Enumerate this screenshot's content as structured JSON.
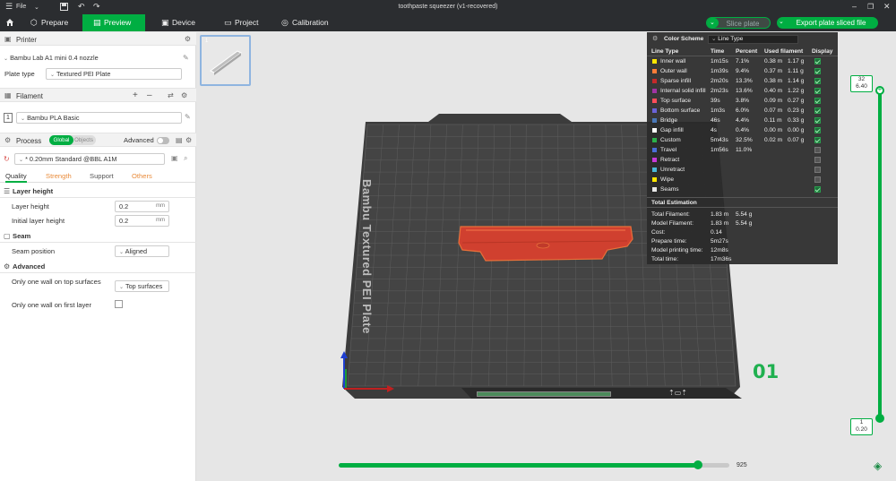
{
  "window": {
    "title": "toothpaste squeezer (v1-recovered)",
    "file_menu": "File"
  },
  "tabs": [
    {
      "label": "Prepare"
    },
    {
      "label": "Preview"
    },
    {
      "label": "Device"
    },
    {
      "label": "Project"
    },
    {
      "label": "Calibration"
    }
  ],
  "toolbar": {
    "slice_label": "Slice plate",
    "export_label": "Export plate sliced file"
  },
  "printer": {
    "header": "Printer",
    "name": "Bambu Lab A1 mini 0.4 nozzle",
    "plate_type_label": "Plate type",
    "plate_type_value": "Textured PEI Plate"
  },
  "filament": {
    "header": "Filament",
    "slot": "1",
    "name": "Bambu PLA Basic"
  },
  "process": {
    "header": "Process",
    "global_label": "Global",
    "objects_label": "Objects",
    "advanced_label": "Advanced",
    "preset": "* 0.20mm Standard @BBL A1M",
    "subtabs": [
      "Quality",
      "Strength",
      "Support",
      "Others"
    ]
  },
  "quality": {
    "layer_height_header": "Layer height",
    "layer_height_label": "Layer height",
    "layer_height_value": "0.2",
    "initial_layer_height_label": "Initial layer height",
    "initial_layer_height_value": "0.2",
    "unit": "mm",
    "seam_header": "Seam",
    "seam_position_label": "Seam position",
    "seam_position_value": "Aligned",
    "advanced_header": "Advanced",
    "one_wall_top_label": "Only one wall on top surfaces",
    "one_wall_top_value": "Top surfaces",
    "one_wall_first_label": "Only one wall on first layer"
  },
  "plate": {
    "bed_label": "Bambu Textured PEI Plate",
    "number": "01",
    "thumb_number": "1"
  },
  "layer_slider": {
    "top_layer": "32",
    "top_height": "6.40",
    "bottom_layer": "1",
    "bottom_height": "0.20"
  },
  "move_slider": {
    "value": "925",
    "fraction": 0.92
  },
  "color_scheme": {
    "title": "Color Scheme",
    "mode": "Line Type",
    "headers": [
      "Line Type",
      "Time",
      "Percent",
      "Used filament",
      "Display"
    ],
    "rows": [
      {
        "name": "Inner wall",
        "color": "#ffe600",
        "time": "1m15s",
        "percent": "7.1%",
        "m": "0.38 m",
        "g": "1.17 g",
        "display": true
      },
      {
        "name": "Outer wall",
        "color": "#ff7d38",
        "time": "1m39s",
        "percent": "9.4%",
        "m": "0.37 m",
        "g": "1.11 g",
        "display": true
      },
      {
        "name": "Sparse infill",
        "color": "#c42a2a",
        "time": "2m20s",
        "percent": "13.3%",
        "m": "0.38 m",
        "g": "1.14 g",
        "display": true
      },
      {
        "name": "Internal solid infill",
        "color": "#a034a4",
        "time": "2m23s",
        "percent": "13.6%",
        "m": "0.40 m",
        "g": "1.22 g",
        "display": true
      },
      {
        "name": "Top surface",
        "color": "#ff4d5a",
        "time": "39s",
        "percent": "3.8%",
        "m": "0.09 m",
        "g": "0.27 g",
        "display": true
      },
      {
        "name": "Bottom surface",
        "color": "#6a63d8",
        "time": "1m3s",
        "percent": "6.0%",
        "m": "0.07 m",
        "g": "0.23 g",
        "display": true
      },
      {
        "name": "Bridge",
        "color": "#4a78b8",
        "time": "46s",
        "percent": "4.4%",
        "m": "0.11 m",
        "g": "0.33 g",
        "display": true
      },
      {
        "name": "Gap infill",
        "color": "#ffffff",
        "time": "4s",
        "percent": "0.4%",
        "m": "0.00 m",
        "g": "0.00 g",
        "display": true
      },
      {
        "name": "Custom",
        "color": "#2bb04a",
        "time": "5m43s",
        "percent": "32.5%",
        "m": "0.02 m",
        "g": "0.07 g",
        "display": true
      },
      {
        "name": "Travel",
        "color": "#4a6ed8",
        "time": "1m56s",
        "percent": "11.0%",
        "m": "",
        "g": "",
        "display": false
      },
      {
        "name": "Retract",
        "color": "#c83ad8",
        "time": "",
        "percent": "",
        "m": "",
        "g": "",
        "display": false
      },
      {
        "name": "Unretract",
        "color": "#4ab8d8",
        "time": "",
        "percent": "",
        "m": "",
        "g": "",
        "display": false
      },
      {
        "name": "Wipe",
        "color": "#ffe600",
        "time": "",
        "percent": "",
        "m": "",
        "g": "",
        "display": false
      },
      {
        "name": "Seams",
        "color": "#e8e8e8",
        "time": "",
        "percent": "",
        "m": "",
        "g": "",
        "display": true
      }
    ],
    "total_title": "Total Estimation",
    "totals": [
      {
        "label": "Total Filament:",
        "v1": "1.83 m",
        "v2": "5.54 g"
      },
      {
        "label": "Model Filament:",
        "v1": "1.83 m",
        "v2": "5.54 g"
      },
      {
        "label": "Cost:",
        "v1": "0.14",
        "v2": ""
      },
      {
        "label": "Prepare time:",
        "v1": "5m27s",
        "v2": ""
      },
      {
        "label": "Model printing time:",
        "v1": "12m8s",
        "v2": ""
      },
      {
        "label": "Total time:",
        "v1": "17m36s",
        "v2": ""
      }
    ]
  },
  "colors": {
    "accent": "#00ae42",
    "topbar": "#2b2d30",
    "bed": "#3a3a3a",
    "model": "#d0402f"
  }
}
